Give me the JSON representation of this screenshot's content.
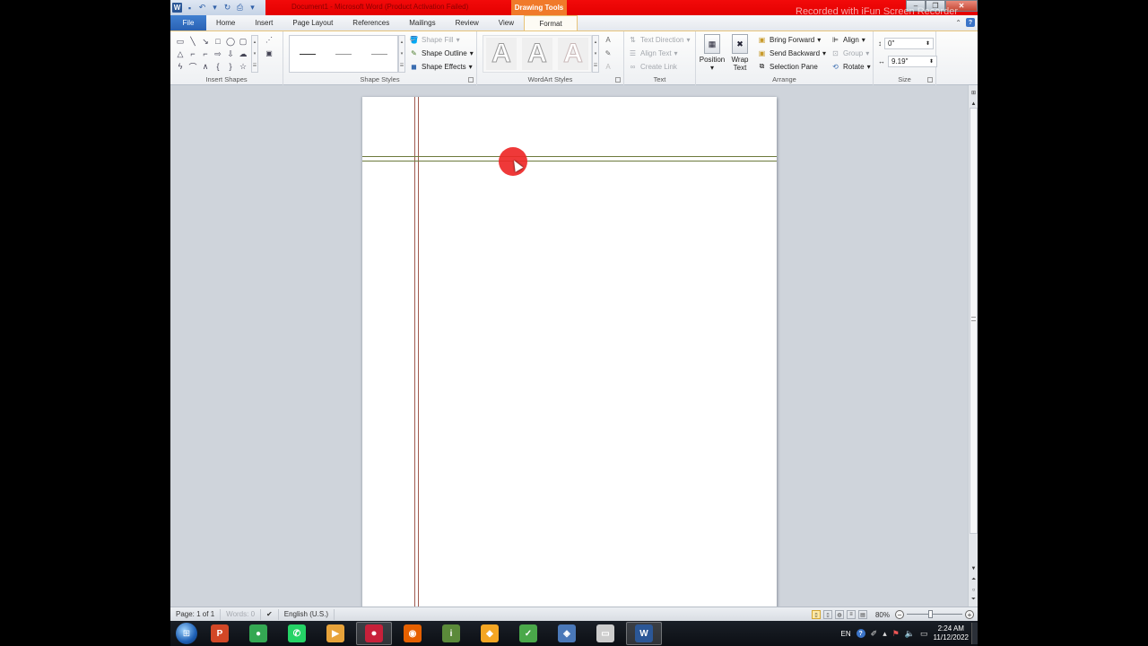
{
  "app": {
    "window_title": "Document1 - Microsoft Word (Product Activation Failed)",
    "contextual_tab_header": "Drawing Tools",
    "watermark": "Recorded with iFun Screen Recorder",
    "window_controls": {
      "minimize": "–",
      "restore": "❐",
      "close": "✕"
    },
    "quick_access": [
      {
        "name": "word-logo-icon",
        "glyph": "W"
      },
      {
        "name": "save-icon",
        "glyph": "💾"
      },
      {
        "name": "undo-icon",
        "glyph": "↶"
      },
      {
        "name": "redo-icon",
        "glyph": "↻"
      },
      {
        "name": "print-preview-icon",
        "glyph": "⎙"
      },
      {
        "name": "customize-qat-icon",
        "glyph": "▾"
      }
    ]
  },
  "tabs": [
    {
      "label": "File"
    },
    {
      "label": "Home"
    },
    {
      "label": "Insert"
    },
    {
      "label": "Page Layout"
    },
    {
      "label": "References"
    },
    {
      "label": "Mailings"
    },
    {
      "label": "Review"
    },
    {
      "label": "View"
    },
    {
      "label": "Format",
      "active": true
    }
  ],
  "ribbon": {
    "insert_shapes": {
      "label": "Insert Shapes",
      "shapes": [
        "▭",
        "╲",
        "↘",
        "□",
        "◯",
        "▢",
        "△",
        "⌐",
        "⌐",
        "⇨",
        "⇩",
        "☁",
        "ϟ",
        "⌒",
        "∧",
        "{",
        "}",
        "☆"
      ],
      "edit_shape": "⋰",
      "text_box": "▣"
    },
    "shape_styles": {
      "label": "Shape Styles",
      "shape_fill": "Shape Fill",
      "shape_outline": "Shape Outline",
      "shape_effects": "Shape Effects"
    },
    "wordart_styles": {
      "label": "WordArt Styles",
      "letters": [
        "A",
        "A",
        "A"
      ],
      "text_fill": "A",
      "text_outline": "✎",
      "text_effects": "A"
    },
    "text": {
      "label": "Text",
      "text_direction": "Text Direction",
      "align_text": "Align Text",
      "create_link": "Create Link"
    },
    "arrange": {
      "label": "Arrange",
      "position": "Position",
      "wrap_text": "Wrap Text",
      "bring_forward": "Bring Forward",
      "send_backward": "Send Backward",
      "selection_pane": "Selection Pane",
      "align": "Align",
      "group": "Group",
      "rotate": "Rotate"
    },
    "size": {
      "label": "Size",
      "height": "0\"",
      "width": "9.19\""
    }
  },
  "status_bar": {
    "page": "Page: 1 of 1",
    "words": "Words: 0",
    "language": "English (U.S.)",
    "zoom": "80%",
    "zoom_fraction": 0.42
  },
  "taskbar": {
    "apps": [
      {
        "name": "powerpoint",
        "glyph": "P",
        "color": "#d24726"
      },
      {
        "name": "chrome",
        "glyph": "●",
        "color": "#34a853"
      },
      {
        "name": "whatsapp",
        "glyph": "✆",
        "color": "#25d366"
      },
      {
        "name": "media-player",
        "glyph": "▶",
        "color": "#e8a33a"
      },
      {
        "name": "screen-recorder",
        "glyph": "⏺",
        "color": "#c8203a",
        "active": true
      },
      {
        "name": "firefox",
        "glyph": "◉",
        "color": "#e66000"
      },
      {
        "name": "tool-app",
        "glyph": "i",
        "color": "#5b8a3a"
      },
      {
        "name": "paint-app",
        "glyph": "◆",
        "color": "#f5a623"
      },
      {
        "name": "coreldraw",
        "glyph": "✓",
        "color": "#4aa84a"
      },
      {
        "name": "network-app",
        "glyph": "◈",
        "color": "#4a78b8"
      },
      {
        "name": "window-app",
        "glyph": "▭",
        "color": "#cccccc"
      },
      {
        "name": "word",
        "glyph": "W",
        "color": "#2b5797",
        "active": true
      }
    ],
    "tray": {
      "language": "EN",
      "time": "2:24 AM",
      "date": "11/12/2022"
    }
  }
}
